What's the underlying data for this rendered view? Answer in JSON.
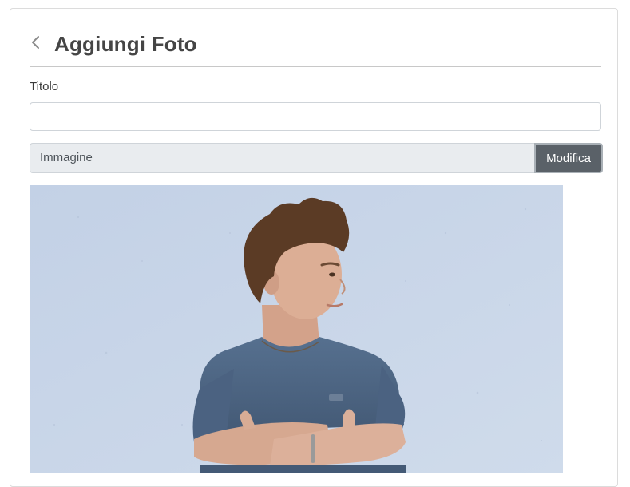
{
  "page": {
    "title": "Aggiungi Foto",
    "back_icon": "chevron-left-icon"
  },
  "form": {
    "title_label": "Titolo",
    "title_value": "",
    "image_label": "Immagine",
    "image_button": "Modifica"
  },
  "photo": {
    "icon": "photo-preview",
    "subject": "teen boy with crossed arms against a light blue wall",
    "wall_color": "#c9d6e8",
    "shirt_color": "#4d6380",
    "hair_color": "#5a3a24"
  }
}
